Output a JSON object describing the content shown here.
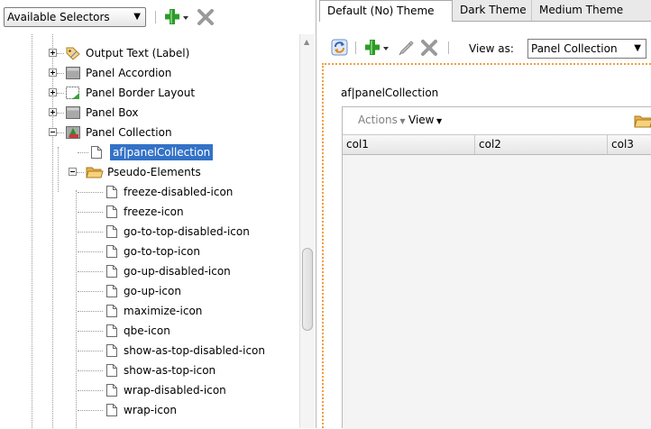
{
  "left_toolbar": {
    "selector_dropdown": "Available Selectors",
    "add_icon": "green-plus-icon",
    "delete_icon": "gray-x-icon"
  },
  "tree": [
    {
      "label": "Output Text (Label)",
      "icon": "tag-icon",
      "level": 1,
      "expander": "plus"
    },
    {
      "label": "Panel Accordion",
      "icon": "gray-box-icon",
      "level": 1,
      "expander": "plus"
    },
    {
      "label": "Panel Border Layout",
      "icon": "border-layout-icon",
      "level": 1,
      "expander": "plus"
    },
    {
      "label": "Panel Box",
      "icon": "gray-box-icon",
      "level": 1,
      "expander": "plus"
    },
    {
      "label": "Panel Collection",
      "icon": "panel-collection-icon",
      "level": 1,
      "expander": "minus"
    },
    {
      "label": "af|panelCollection",
      "icon": "page-icon",
      "level": 2,
      "expander": "none",
      "selected": true
    },
    {
      "label": "Pseudo-Elements",
      "icon": "folder-icon",
      "level": 2,
      "expander": "minus"
    },
    {
      "label": "freeze-disabled-icon",
      "icon": "page-icon",
      "level": 3,
      "expander": "none"
    },
    {
      "label": "freeze-icon",
      "icon": "page-icon",
      "level": 3,
      "expander": "none"
    },
    {
      "label": "go-to-top-disabled-icon",
      "icon": "page-icon",
      "level": 3,
      "expander": "none"
    },
    {
      "label": "go-to-top-icon",
      "icon": "page-icon",
      "level": 3,
      "expander": "none"
    },
    {
      "label": "go-up-disabled-icon",
      "icon": "page-icon",
      "level": 3,
      "expander": "none"
    },
    {
      "label": "go-up-icon",
      "icon": "page-icon",
      "level": 3,
      "expander": "none"
    },
    {
      "label": "maximize-icon",
      "icon": "page-icon",
      "level": 3,
      "expander": "none"
    },
    {
      "label": "qbe-icon",
      "icon": "page-icon",
      "level": 3,
      "expander": "none"
    },
    {
      "label": "show-as-top-disabled-icon",
      "icon": "page-icon",
      "level": 3,
      "expander": "none"
    },
    {
      "label": "show-as-top-icon",
      "icon": "page-icon",
      "level": 3,
      "expander": "none"
    },
    {
      "label": "wrap-disabled-icon",
      "icon": "page-icon",
      "level": 3,
      "expander": "none"
    },
    {
      "label": "wrap-icon",
      "icon": "page-icon",
      "level": 3,
      "expander": "none"
    }
  ],
  "tabs": [
    {
      "label": "Default (No) Theme",
      "active": true
    },
    {
      "label": "Dark Theme",
      "active": false
    },
    {
      "label": "Medium Theme",
      "active": false
    }
  ],
  "right_toolbar": {
    "refresh_icon": "refresh-icon",
    "add_icon": "green-plus-icon",
    "edit_icon": "pencil-icon",
    "delete_icon": "gray-x-icon",
    "view_as_label": "View as:",
    "view_as_value": "Panel Collection"
  },
  "preview": {
    "component_label": "af|panelCollection",
    "actions_menu": "Actions",
    "view_menu": "View",
    "columns": [
      "col1",
      "col2",
      "col3"
    ]
  },
  "colors": {
    "selection": "#3372c7",
    "canvas_border": "#f0a040"
  }
}
